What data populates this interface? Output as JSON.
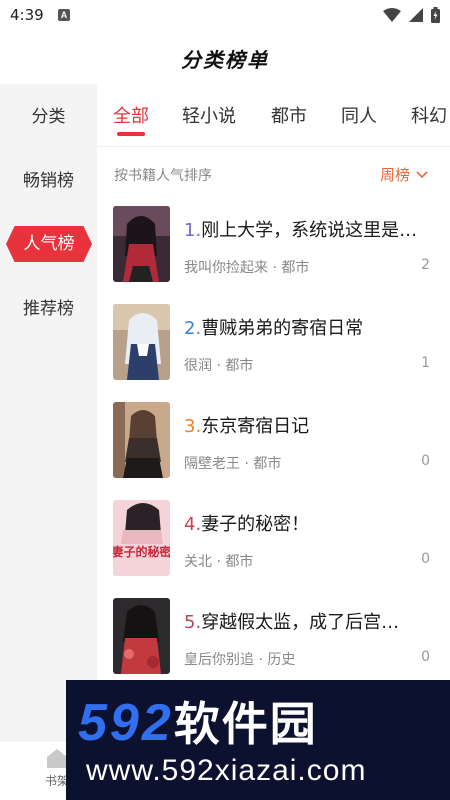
{
  "status": {
    "time": "4:39",
    "notif_badge": "A"
  },
  "header": {
    "title": "分类榜单"
  },
  "sidenav": {
    "items": [
      {
        "label": "分类"
      },
      {
        "label": "畅销榜"
      },
      {
        "label": "人气榜",
        "active": true
      },
      {
        "label": "推荐榜"
      }
    ]
  },
  "tabs": [
    {
      "label": "全部",
      "active": true
    },
    {
      "label": "轻小说"
    },
    {
      "label": "都市"
    },
    {
      "label": "同人"
    },
    {
      "label": "科幻"
    }
  ],
  "sort": {
    "label": "按书籍人气排序",
    "selected": "周榜"
  },
  "books": [
    {
      "rank": "1.",
      "title": "刚上大学，系统说这里是…",
      "meta": "我叫你捡起来 · 都市",
      "count": "2"
    },
    {
      "rank": "2.",
      "title": "曹贼弟弟的寄宿日常",
      "meta": "很润 · 都市",
      "count": "1"
    },
    {
      "rank": "3.",
      "title": "东京寄宿日记",
      "meta": "隔壁老王 · 都市",
      "count": "0"
    },
    {
      "rank": "4.",
      "title": "妻子的秘密！",
      "meta": "关北 · 都市",
      "count": "0",
      "cover_text": "妻子的秘密"
    },
    {
      "rank": "5.",
      "title": "穿越假太监，成了后宫…",
      "meta": "皇后你别追 · 历史",
      "count": "0"
    }
  ],
  "bottom_bar": {
    "shelf_label": "书架"
  },
  "watermark": {
    "logo_num": "592",
    "logo_cn": "软件园",
    "url": "www.592xiazai.com"
  },
  "colors": {
    "accent": "#e8323c",
    "sort_accent": "#e8663c",
    "watermark_bg": "#0d1130",
    "watermark_blue": "#2f6ff0"
  }
}
